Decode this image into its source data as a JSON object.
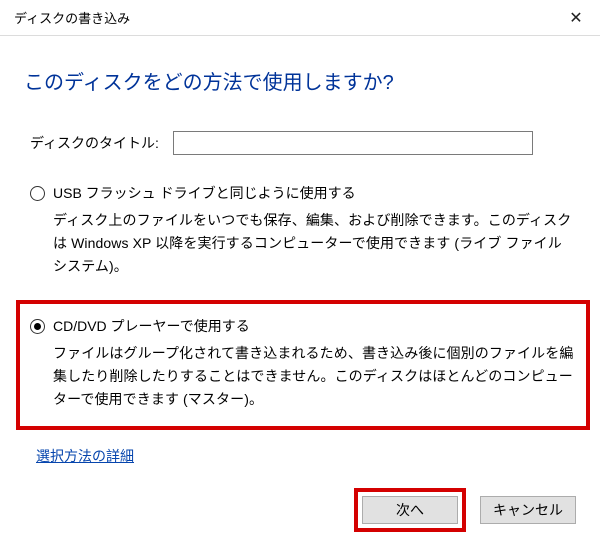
{
  "window": {
    "title": "ディスクの書き込み",
    "close_icon": "✕"
  },
  "heading": "このディスクをどの方法で使用しますか?",
  "disc_title": {
    "label": "ディスクのタイトル:",
    "value": ""
  },
  "options": {
    "usb": {
      "label": "USB フラッシュ ドライブと同じように使用する",
      "desc": "ディスク上のファイルをいつでも保存、編集、および削除できます。このディスクは Windows XP 以降を実行するコンピューターで使用できます (ライブ ファイル システム)。",
      "selected": false
    },
    "cddvd": {
      "label": "CD/DVD プレーヤーで使用する",
      "desc": "ファイルはグループ化されて書き込まれるため、書き込み後に個別のファイルを編集したり削除したりすることはできません。このディスクはほとんどのコンピューターで使用できます (マスター)。",
      "selected": true
    }
  },
  "details_link": "選択方法の詳細",
  "buttons": {
    "next": "次へ",
    "cancel": "キャンセル"
  }
}
